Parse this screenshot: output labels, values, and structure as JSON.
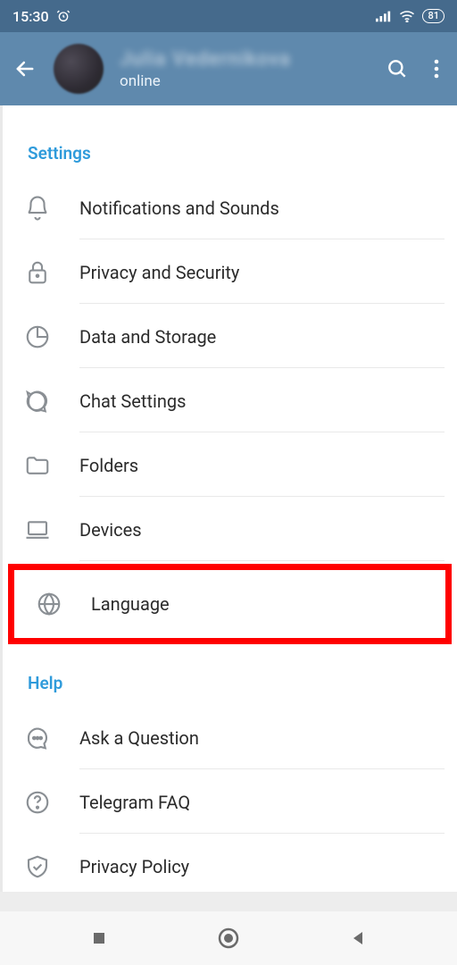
{
  "status": {
    "time": "15:30",
    "battery": "81"
  },
  "header": {
    "name": "Julia Vedernikova",
    "status": "online"
  },
  "sections": {
    "settings_title": "Settings",
    "help_title": "Help"
  },
  "settings": {
    "notifications": "Notifications and Sounds",
    "privacy": "Privacy and Security",
    "data": "Data and Storage",
    "chat": "Chat Settings",
    "folders": "Folders",
    "devices": "Devices",
    "language": "Language"
  },
  "help": {
    "ask": "Ask a Question",
    "faq": "Telegram FAQ",
    "policy": "Privacy Policy"
  },
  "highlight": "language"
}
